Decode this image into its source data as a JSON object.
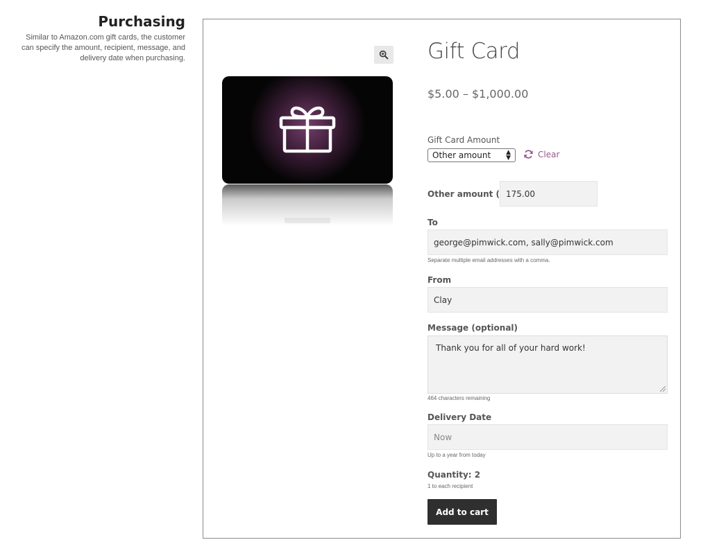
{
  "sidebar": {
    "title": "Purchasing",
    "description": "Similar to Amazon.com gift cards, the customer can specify the amount, recipient, message, and delivery date when purchasing."
  },
  "product": {
    "title": "Gift Card",
    "price": "$5.00 – $1,000.00"
  },
  "form": {
    "amount_label": "Gift Card Amount",
    "amount_selected": "Other amount",
    "clear_label": "Clear",
    "other_amount_label": "Other amount ($)",
    "other_amount_value": "175.00",
    "to_label": "To",
    "to_value": "george@pimwick.com, sally@pimwick.com",
    "to_hint": "Separate multiple email addresses with a comma.",
    "from_label": "From",
    "from_value": "Clay",
    "message_label": "Message (optional)",
    "message_value": "Thank you for all of your hard work!",
    "message_hint": "464 characters remaining",
    "delivery_label": "Delivery Date",
    "delivery_placeholder": "Now",
    "delivery_hint": "Up to a year from today",
    "quantity_label": "Quantity: 2",
    "quantity_hint": "1 to each recipient",
    "add_to_cart": "Add to cart"
  },
  "colors": {
    "accent": "#96588a",
    "button_bg": "#2f2f2f",
    "input_bg": "#f2f2f2"
  },
  "icons": {
    "zoom": "zoom-in-icon",
    "gift": "gift-icon",
    "clear": "refresh-icon"
  }
}
